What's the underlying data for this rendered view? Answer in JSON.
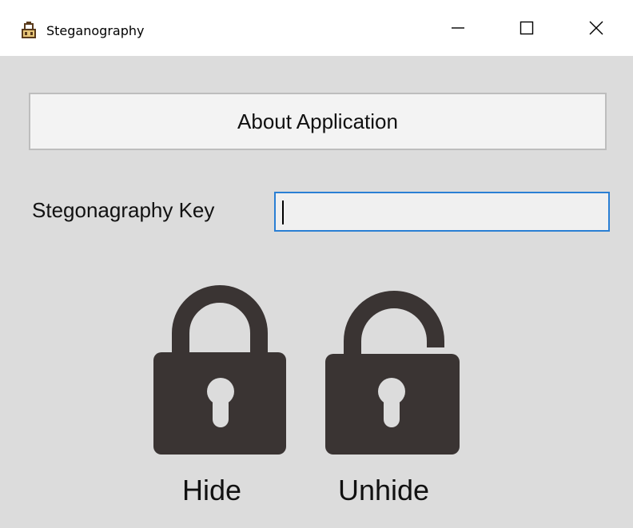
{
  "window": {
    "title": "Steganography",
    "controls": {
      "minimize": "minimize-icon",
      "maximize": "maximize-icon",
      "close": "close-icon"
    }
  },
  "main": {
    "about_button_label": "About Application",
    "key_label": "Stegonagraphy Key",
    "key_input_value": "",
    "hide_label": "Hide",
    "unhide_label": "Unhide"
  },
  "icons": {
    "app": "app-icon",
    "hide": "locked-padlock-icon",
    "unhide": "unlocked-padlock-icon"
  },
  "colors": {
    "window_background": "#dcdcdc",
    "input_focus_border": "#2a7fd4",
    "lock_color": "#3a3433"
  }
}
